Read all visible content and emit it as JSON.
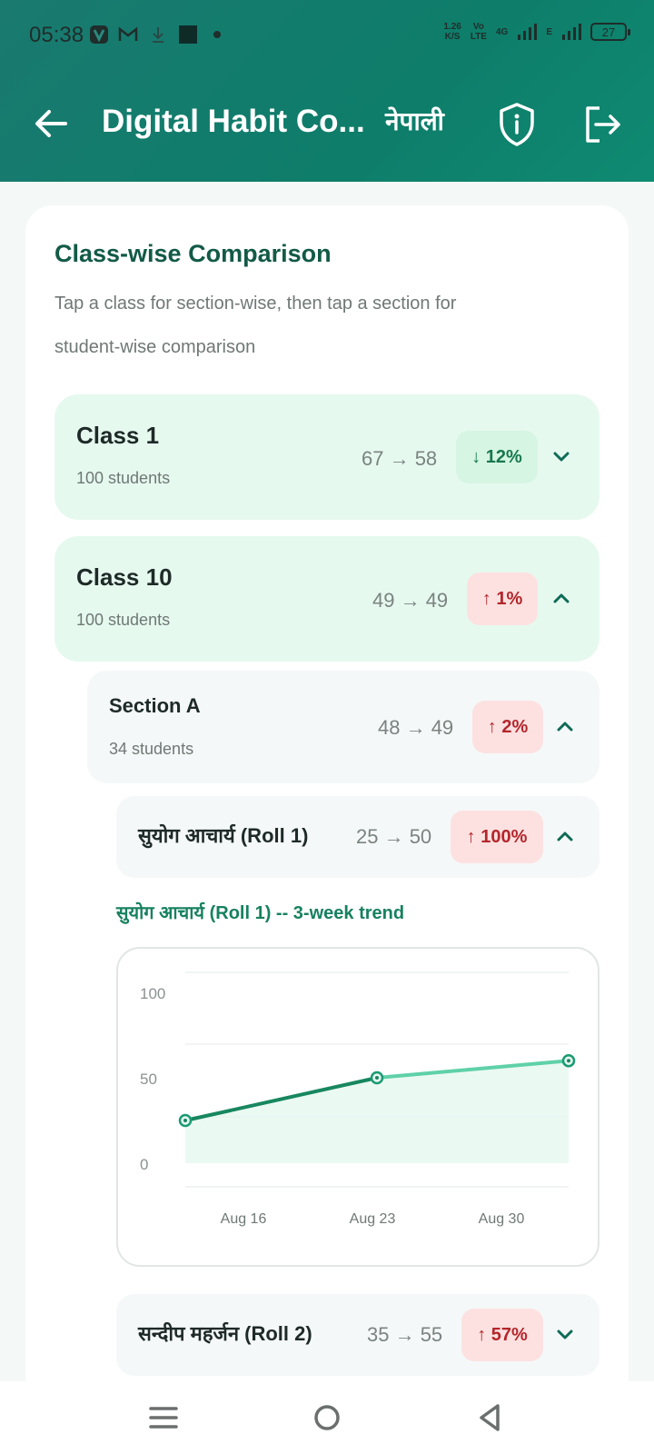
{
  "status_bar": {
    "time": "05:38",
    "speed_value": "1.26",
    "speed_unit": "K/S",
    "volte_top": "Vo",
    "volte_bottom": "LTE",
    "net_type": "4G",
    "net_type2": "E",
    "battery": "27"
  },
  "header": {
    "title": "Digital Habit Co...",
    "language": "नेपाली",
    "icons": [
      "back-arrow-icon",
      "shield-info-icon",
      "logout-icon"
    ]
  },
  "comparison": {
    "title": "Class-wise Comparison",
    "description": "Tap a class for section-wise, then tap a section for student-wise comparison",
    "classes": [
      {
        "name": "Class 1",
        "students": "100 students",
        "values": "67 → 58",
        "change": "↓ 12%",
        "direction": "down",
        "expanded": false
      },
      {
        "name": "Class 10",
        "students": "100 students",
        "values": "49 → 49",
        "change": "↑ 1%",
        "direction": "up",
        "expanded": true
      }
    ],
    "section": {
      "name": "Section A",
      "students": "34 students",
      "values": "48 → 49",
      "change": "↑ 2%",
      "direction": "up",
      "expanded": true
    },
    "students": [
      {
        "name": "सुयोग आचार्य (Roll 1)",
        "values": "25 → 50",
        "change": "↑ 100%",
        "direction": "up",
        "expanded": true
      },
      {
        "name": "सन्दीप महर्जन (Roll 2)",
        "values": "35 → 55",
        "change": "↑ 57%",
        "direction": "up",
        "expanded": false
      }
    ],
    "trend_title": "सुयोग आचार्य (Roll 1) -- 3-week trend"
  },
  "colors": {
    "brand": "#0e7d6a",
    "positive_badge": "#d6f5e2",
    "negative_badge": "#fde1e1",
    "line": "#1a9a72"
  },
  "chart_data": {
    "type": "line",
    "title": "सुयोग आचार्य (Roll 1) -- 3-week trend",
    "x": [
      "Aug 16",
      "Aug 23",
      "Aug 30"
    ],
    "series": [
      {
        "values": [
          25,
          50,
          60
        ]
      }
    ],
    "y_ticks": [
      "100",
      "50",
      "0"
    ],
    "ylim": [
      0,
      100
    ],
    "grid": true,
    "area_fill": true
  },
  "bottom_nav": {
    "icons": [
      "menu-icon",
      "home-circle-icon",
      "back-triangle-icon"
    ]
  }
}
